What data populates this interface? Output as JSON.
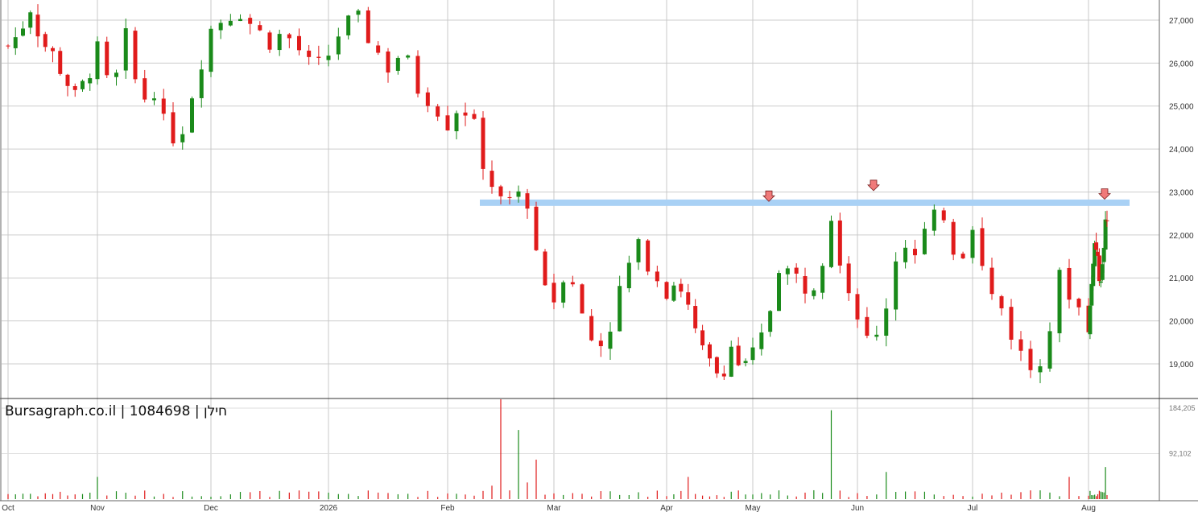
{
  "watermark": "Bursagraph.co.il | 1084698 | חילן",
  "chart_data": [
    {
      "type": "candlestick",
      "title": "",
      "x_ticks": [
        "Oct",
        "Nov",
        "Dec",
        "2026",
        "Feb",
        "Mar",
        "Apr",
        "May",
        "Jun",
        "Jul",
        "Aug"
      ],
      "y_ticks": [
        "19,000",
        "20,000",
        "21,000",
        "22,000",
        "23,000",
        "24,000",
        "25,000",
        "26,000",
        "27,000"
      ],
      "y_tick_values": [
        19000,
        20000,
        21000,
        22000,
        23000,
        24000,
        25000,
        26000,
        27000
      ],
      "ylim": [
        18200,
        27500
      ],
      "grid": true,
      "up_color": "#1a8a1a",
      "down_color": "#e01b1b",
      "resistance_level": 22750,
      "resistance_color": "#a9d1f5",
      "resistance_from": "Feb",
      "marker_color": "#f07a7a",
      "markers": [
        {
          "date": "May",
          "value": 22650
        },
        {
          "date": "Jun",
          "value": 22900
        },
        {
          "date": "Aug",
          "value": 22700
        }
      ],
      "path": [
        [
          0,
          26400
        ],
        [
          3,
          26700
        ],
        [
          6,
          27300
        ],
        [
          9,
          26500
        ],
        [
          12,
          26200
        ],
        [
          15,
          25700
        ],
        [
          18,
          25200
        ],
        [
          21,
          25600
        ],
        [
          24,
          26300
        ],
        [
          27,
          25200
        ],
        [
          30,
          26600
        ],
        [
          33,
          25100
        ],
        [
          36,
          25400
        ],
        [
          39,
          24200
        ],
        [
          42,
          24500
        ],
        [
          45,
          25700
        ],
        [
          48,
          26800
        ],
        [
          51,
          27100
        ],
        [
          54,
          27200
        ],
        [
          57,
          26800
        ],
        [
          60,
          26500
        ],
        [
          63,
          26700
        ],
        [
          66,
          26300
        ],
        [
          69,
          25800
        ],
        [
          72,
          26200
        ],
        [
          75,
          26900
        ],
        [
          78,
          27000
        ],
        [
          81,
          26400
        ],
        [
          84,
          25900
        ],
        [
          87,
          26300
        ],
        [
          90,
          25400
        ],
        [
          93,
          25100
        ],
        [
          96,
          24600
        ],
        [
          99,
          25100
        ],
        [
          102,
          24500
        ],
        [
          105,
          23300
        ],
        [
          108,
          23000
        ],
        [
          111,
          22900
        ],
        [
          114,
          22800
        ],
        [
          117,
          21100
        ],
        [
          120,
          20500
        ],
        [
          123,
          21400
        ],
        [
          126,
          20100
        ],
        [
          129,
          19300
        ],
        [
          132,
          19900
        ],
        [
          135,
          21100
        ],
        [
          138,
          21700
        ],
        [
          141,
          21200
        ],
        [
          144,
          20700
        ],
        [
          147,
          21000
        ],
        [
          150,
          20300
        ],
        [
          153,
          19400
        ],
        [
          156,
          19000
        ],
        [
          159,
          18700
        ],
        [
          162,
          19400
        ],
        [
          165,
          18800
        ],
        [
          168,
          19200
        ],
        [
          171,
          19800
        ],
        [
          174,
          21300
        ],
        [
          177,
          21100
        ],
        [
          180,
          20800
        ],
        [
          183,
          21000
        ],
        [
          186,
          22500
        ],
        [
          189,
          21000
        ],
        [
          192,
          20200
        ],
        [
          195,
          19200
        ],
        [
          198,
          20400
        ],
        [
          201,
          22000
        ],
        [
          204,
          21500
        ],
        [
          207,
          22300
        ],
        [
          210,
          22500
        ],
        [
          213,
          21300
        ],
        [
          216,
          22300
        ],
        [
          219,
          20700
        ],
        [
          222,
          20300
        ],
        [
          225,
          19400
        ],
        [
          228,
          18900
        ],
        [
          231,
          19300
        ],
        [
          234,
          21000
        ],
        [
          237,
          20500
        ],
        [
          240,
          19900
        ],
        [
          243,
          20500
        ],
        [
          246,
          21500
        ],
        [
          249,
          21900
        ],
        [
          252,
          21300
        ],
        [
          255,
          21000
        ],
        [
          258,
          21200
        ],
        [
          261,
          22100
        ],
        [
          264,
          22300
        ]
      ],
      "volume_ticks": [
        "184,205",
        "92,102"
      ],
      "volume_tick_values": [
        184205,
        92102
      ],
      "volume_ylim": [
        0,
        230000
      ],
      "volume_color": "#e01b1b"
    }
  ]
}
